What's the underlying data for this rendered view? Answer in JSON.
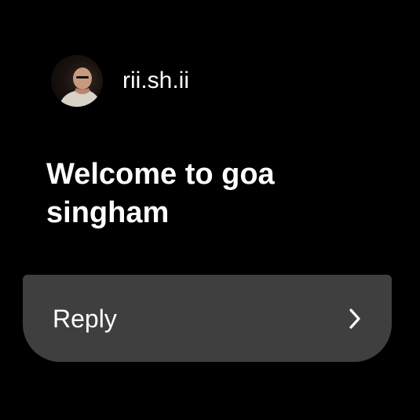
{
  "sender": {
    "name": "rii.sh.ii",
    "avatar": "profile-photo"
  },
  "message": {
    "text": "Welcome to goa singham"
  },
  "reply": {
    "label": "Reply",
    "icon": "chevron-right-icon"
  },
  "colors": {
    "background": "#000000",
    "text": "#ffffff",
    "reply_button": "#3f3f3f"
  }
}
